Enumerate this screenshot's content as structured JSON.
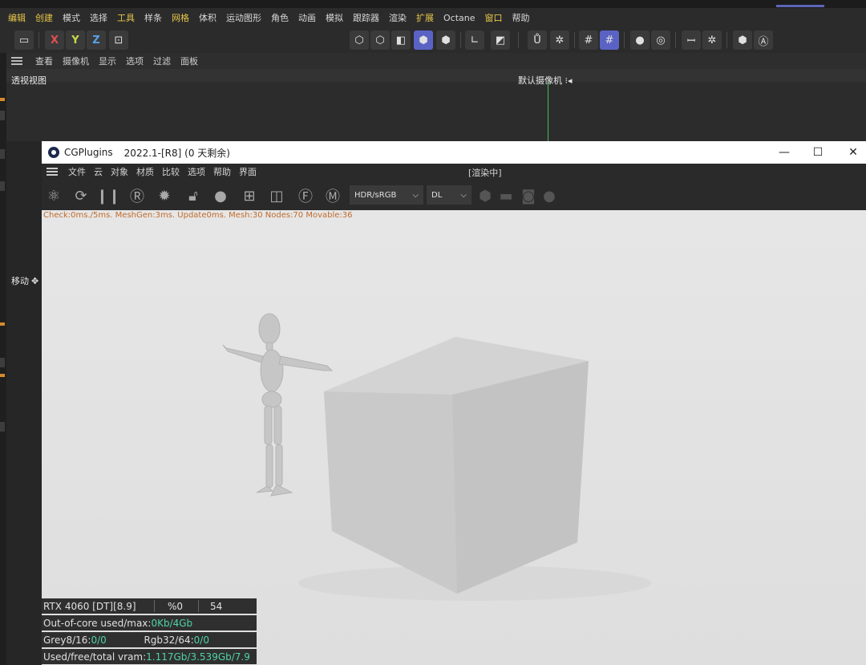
{
  "c4d": {
    "menu": [
      {
        "label": "编辑",
        "hl": true
      },
      {
        "label": "创建",
        "hl": true
      },
      {
        "label": "模式",
        "hl": false
      },
      {
        "label": "选择",
        "hl": false
      },
      {
        "label": "工具",
        "hl": true
      },
      {
        "label": "样条",
        "hl": false
      },
      {
        "label": "网格",
        "hl": true
      },
      {
        "label": "体积",
        "hl": false
      },
      {
        "label": "运动图形",
        "hl": false
      },
      {
        "label": "角色",
        "hl": false
      },
      {
        "label": "动画",
        "hl": false
      },
      {
        "label": "模拟",
        "hl": false
      },
      {
        "label": "跟踪器",
        "hl": false
      },
      {
        "label": "渲染",
        "hl": false
      },
      {
        "label": "扩展",
        "hl": true
      },
      {
        "label": "Octane",
        "hl": false
      },
      {
        "label": "窗口",
        "hl": true
      },
      {
        "label": "帮助",
        "hl": false
      }
    ],
    "axis_buttons": {
      "x": "X",
      "y": "Y",
      "z": "Z"
    },
    "view_menu": [
      "查看",
      "摄像机",
      "显示",
      "选项",
      "过滤",
      "面板"
    ],
    "viewport_title": "透视视图",
    "camera_label": "默认摄像机 ⁝◂",
    "move_label": "移动",
    "colors": {
      "accent": "#5a63c4",
      "highlight_menu": "#e6c64a",
      "green_axis": "#3fbf5a"
    }
  },
  "octane": {
    "title_app": "CGPlugins",
    "title_version": "2022.1-[R8] (0 天剩余)",
    "window_controls": {
      "minimize": "—",
      "maximize": "☐",
      "close": "✕"
    },
    "menu": [
      "文件",
      "云",
      "对象",
      "材质",
      "比较",
      "选项",
      "帮助",
      "界面"
    ],
    "status": "[渲染中]",
    "color_space": "HDR/sRGB",
    "kernel": "DL",
    "check_line": "Check:0ms./5ms. MeshGen:3ms. Update0ms. Mesh:30 Nodes:70 Movable:36",
    "stats": {
      "gpu": "RTX 4060 [DT][8.9]",
      "percent": "%0",
      "count": "54",
      "ooc_label": "Out-of-core used/max:",
      "ooc_value": "0Kb/4Gb",
      "grey_label": "Grey8/16: ",
      "grey_value": "0/0",
      "rgb_label": "Rgb32/64: ",
      "rgb_value": "0/0",
      "vram_label": "Used/free/total vram: ",
      "vram_value": "1.117Gb/3.539Gb/7.9"
    },
    "colors": {
      "stat_value": "#4fd2a8",
      "check_text": "#c06a2a",
      "render_bg": "#e4e4e4"
    }
  }
}
